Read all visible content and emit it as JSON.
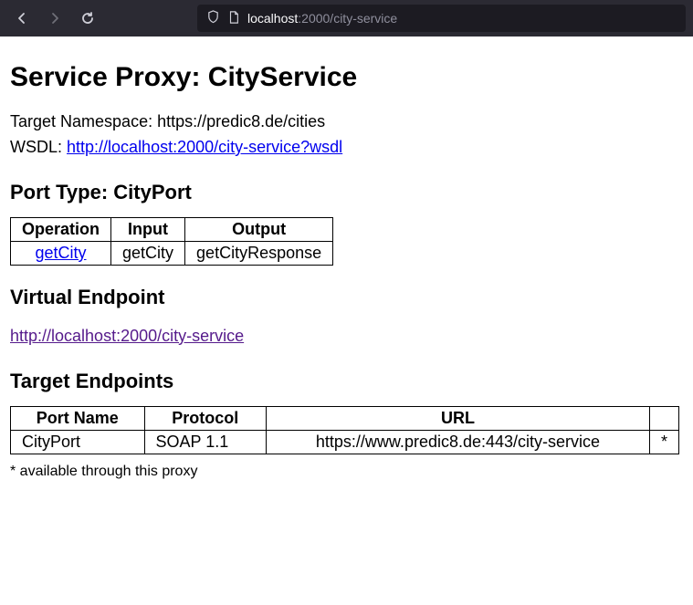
{
  "browser": {
    "url_dim_prefix": "localhost",
    "url_main": ":2000/city-service"
  },
  "page": {
    "title": "Service Proxy: CityService",
    "target_namespace_label": "Target Namespace: ",
    "target_namespace_value": "https://predic8.de/cities",
    "wsdl_label": "WSDL: ",
    "wsdl_url": "http://localhost:2000/city-service?wsdl",
    "port_type_heading": "Port Type: CityPort",
    "port_type_table": {
      "headers": [
        "Operation",
        "Input",
        "Output"
      ],
      "rows": [
        {
          "operation": "getCity",
          "input": "getCity",
          "output": "getCityResponse"
        }
      ]
    },
    "virtual_endpoint_heading": "Virtual Endpoint",
    "virtual_endpoint_url": "http://localhost:2000/city-service",
    "target_endpoints_heading": "Target Endpoints",
    "target_endpoints_table": {
      "headers": [
        "Port Name",
        "Protocol",
        "URL",
        ""
      ],
      "rows": [
        {
          "port_name": "CityPort",
          "protocol": "SOAP 1.1",
          "url": "https://www.predic8.de:443/city-service",
          "flag": "*"
        }
      ]
    },
    "footnote": "* available through this proxy"
  }
}
